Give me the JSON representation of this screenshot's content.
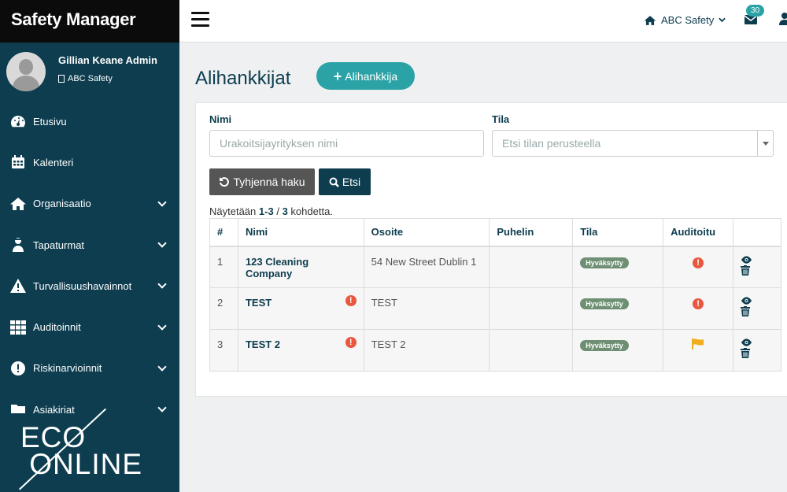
{
  "app": {
    "title": "Safety Manager"
  },
  "user": {
    "name": "Gillian Keane Admin",
    "org": "ABC Safety"
  },
  "sidebar": {
    "items": [
      {
        "label": "Etusivu",
        "icon": "dashboard-icon",
        "expandable": false
      },
      {
        "label": "Kalenteri",
        "icon": "calendar-icon",
        "expandable": false
      },
      {
        "label": "Organisaatio",
        "icon": "home-icon",
        "expandable": true
      },
      {
        "label": "Tapaturmat",
        "icon": "user-injured-icon",
        "expandable": true
      },
      {
        "label": "Turvallisuushavainnot",
        "icon": "warning-icon",
        "expandable": true
      },
      {
        "label": "Auditoinnit",
        "icon": "grid-icon",
        "expandable": true
      },
      {
        "label": "Riskinarvioinnit",
        "icon": "exclamation-icon",
        "expandable": true
      },
      {
        "label": "Asiakirjat",
        "icon": "folder-icon",
        "expandable": true
      }
    ],
    "logo": "ECO ONLINE"
  },
  "topbar": {
    "org_label": "ABC Safety",
    "mail_count": "30"
  },
  "page": {
    "title": "Alihankkijat",
    "add_label": "Alihankkija"
  },
  "filters": {
    "name_label": "Nimi",
    "name_placeholder": "Urakoitsijayrityksen nimi",
    "status_label": "Tila",
    "status_placeholder": "Etsi tilan perusteella",
    "clear_label": "Tyhjennä haku",
    "search_label": "Etsi"
  },
  "results": {
    "prefix": "Näytetään",
    "range": "1-3",
    "sep": "/",
    "total": "3",
    "suffix": "kohdetta."
  },
  "table": {
    "headers": [
      "#",
      "Nimi",
      "Osoite",
      "Puhelin",
      "Tila",
      "Auditoitu",
      ""
    ],
    "rows": [
      {
        "num": "1",
        "name": "123 Cleaning Company",
        "name_warning": false,
        "address": "54 New Street Dublin 1",
        "phone": "",
        "status": "Hyväksytty",
        "audit": "warning"
      },
      {
        "num": "2",
        "name": "TEST",
        "name_warning": true,
        "address": "TEST",
        "phone": "",
        "status": "Hyväksytty",
        "audit": "warning"
      },
      {
        "num": "3",
        "name": "TEST 2",
        "name_warning": true,
        "address": "TEST 2",
        "phone": "",
        "status": "Hyväksytty",
        "audit": "flag"
      }
    ]
  },
  "colors": {
    "sidebar": "#0d3d4f",
    "accent": "#2ba3a6",
    "danger": "#e9573f",
    "flag": "#f0ad1e",
    "status": "#6e8f73"
  }
}
